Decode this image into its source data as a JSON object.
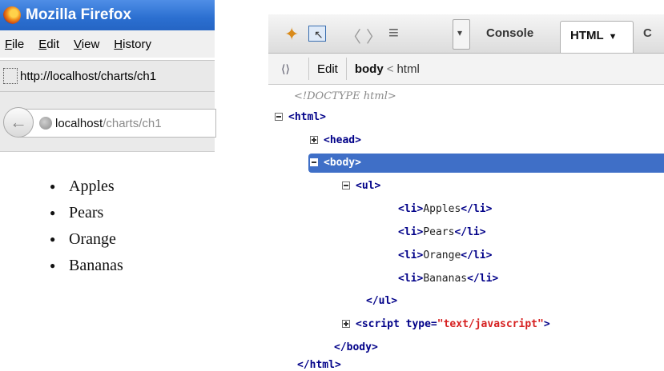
{
  "firefox": {
    "title": "Mozilla Firefox",
    "menu": [
      "File",
      "Edit",
      "View",
      "History"
    ],
    "tab_url": "http://localhost/charts/ch1",
    "urlbar": {
      "host": "localhost",
      "path": "/charts/ch1"
    }
  },
  "page": {
    "items": [
      "Apples",
      "Pears",
      "Orange",
      "Bananas"
    ]
  },
  "firebug": {
    "tabs": {
      "console": "Console",
      "html": "HTML",
      "next": "C"
    },
    "breadcrumb": {
      "edit": "Edit",
      "current": "body",
      "sep": "<",
      "parent": "html"
    },
    "tree": {
      "doctype": "<!DOCTYPE html>",
      "html_open": "<html>",
      "head": "<head>",
      "body_open": "<body>",
      "ul_open": "<ul>",
      "li_open": "<li>",
      "li_close": "</li>",
      "ul_close": "</ul>",
      "script_open": "<script",
      "script_attr": "type=",
      "script_val": "\"text/javascript\"",
      "script_end": ">",
      "body_close": "</body>",
      "html_close": "</html>"
    }
  }
}
